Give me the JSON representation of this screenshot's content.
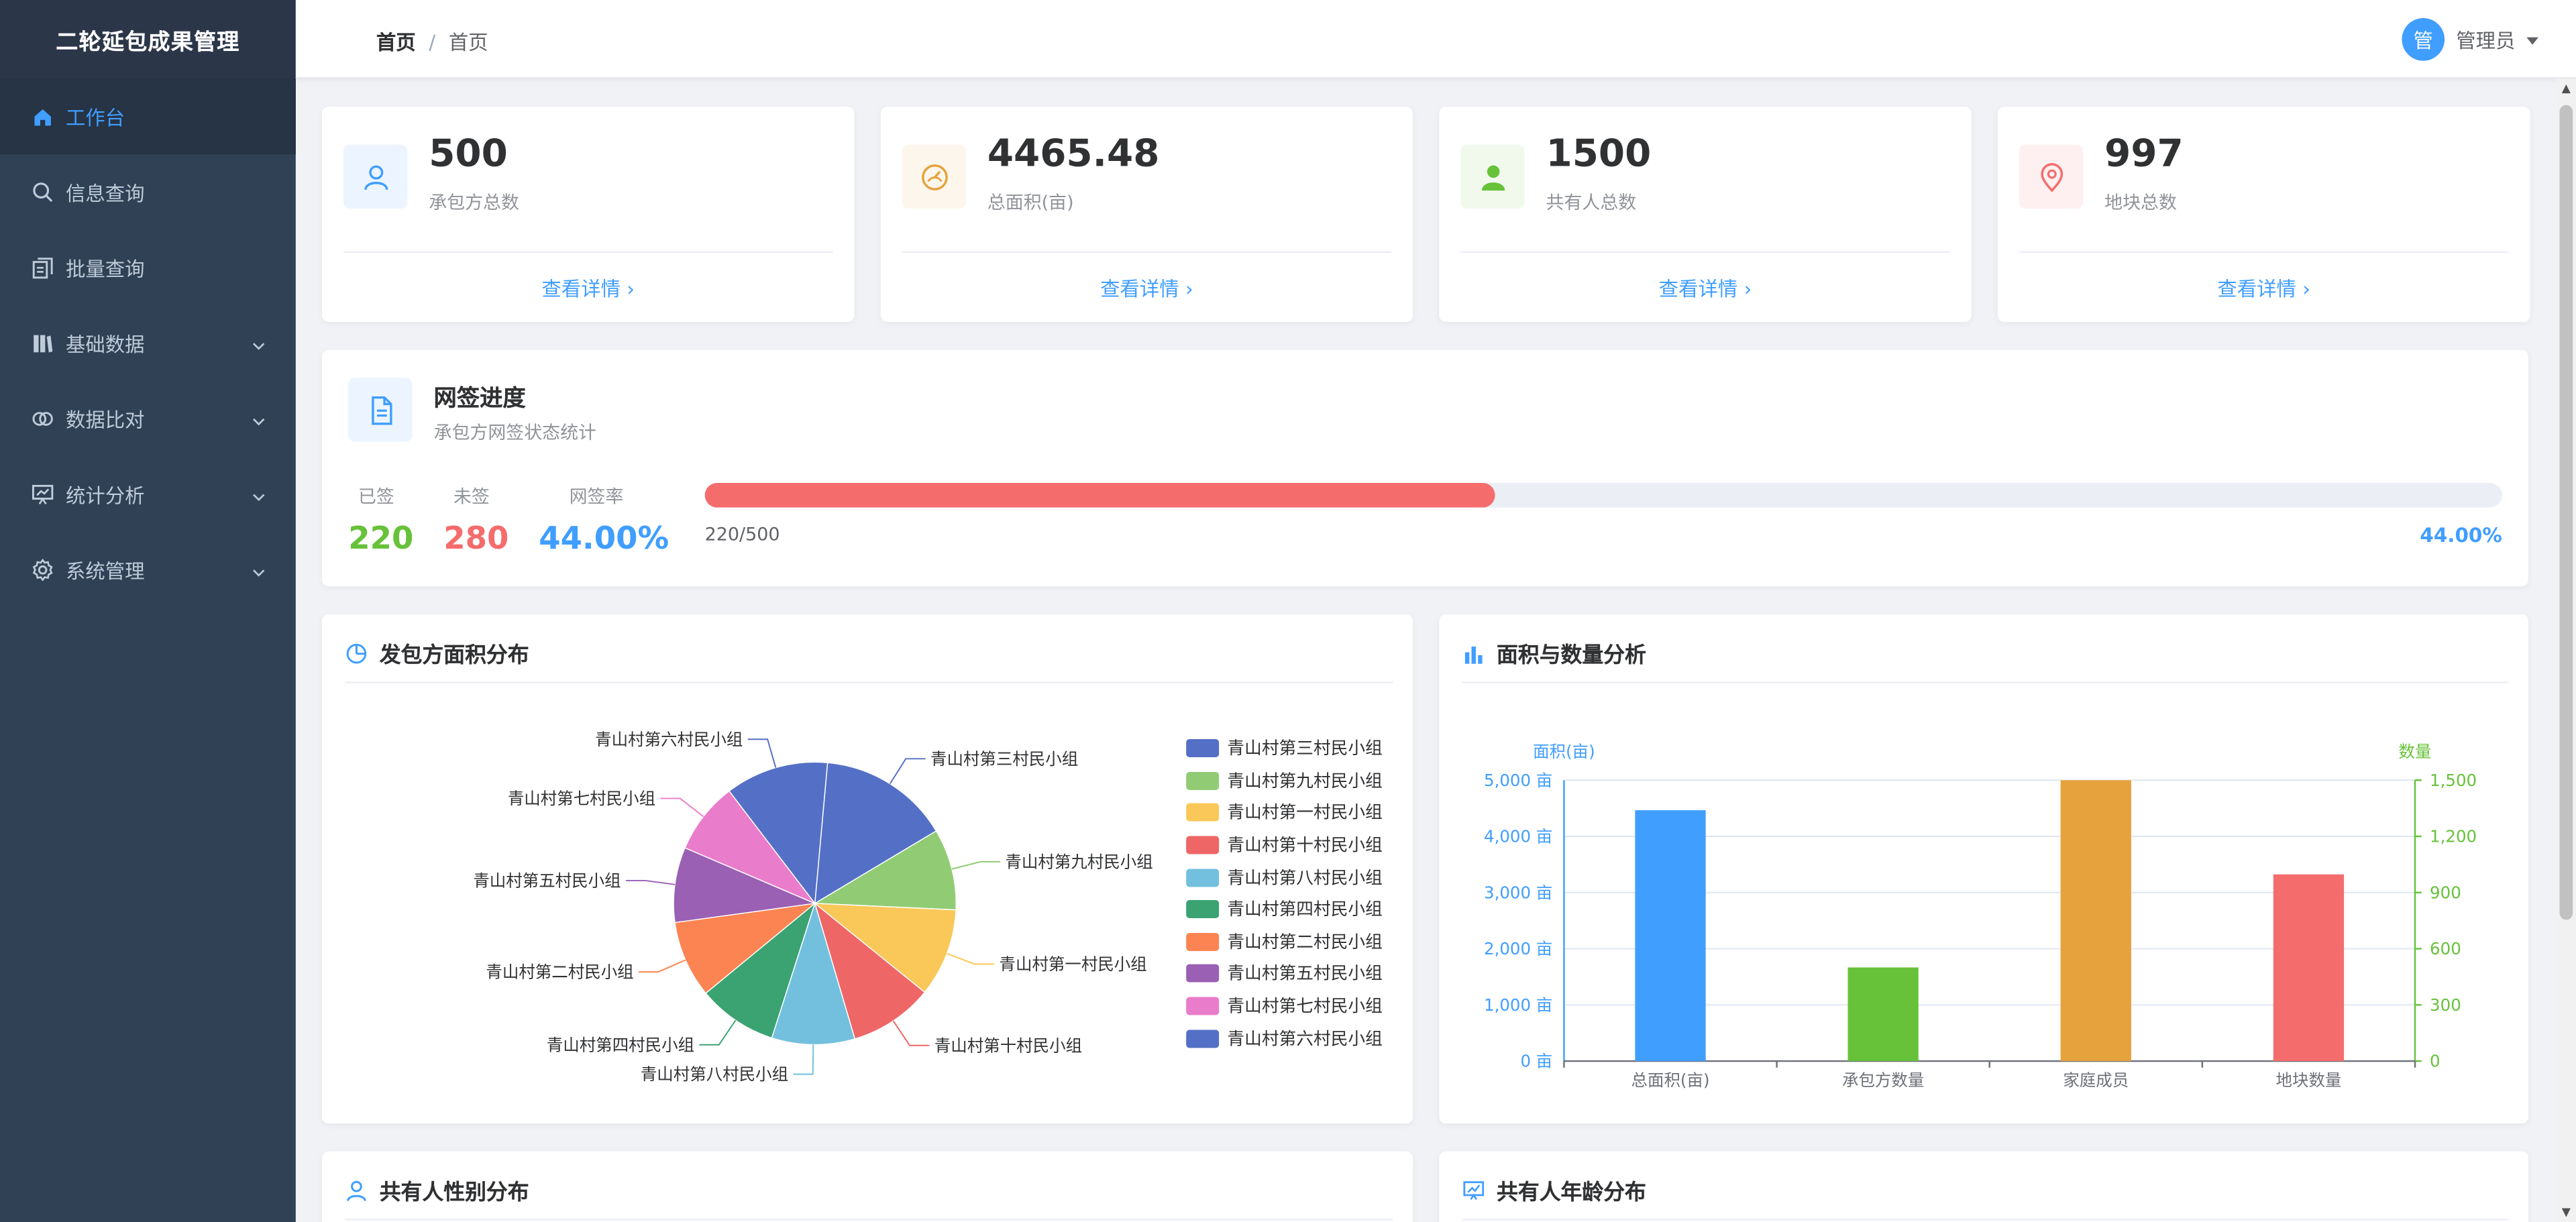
{
  "app": {
    "title": "二轮延包成果管理"
  },
  "sidebar": {
    "items": [
      {
        "label": "工作台",
        "icon": "home-icon",
        "active": true,
        "expandable": false
      },
      {
        "label": "信息查询",
        "icon": "search-icon",
        "active": false,
        "expandable": false
      },
      {
        "label": "批量查询",
        "icon": "documents-icon",
        "active": false,
        "expandable": false
      },
      {
        "label": "基础数据",
        "icon": "books-icon",
        "active": false,
        "expandable": true
      },
      {
        "label": "数据比对",
        "icon": "compare-icon",
        "active": false,
        "expandable": true
      },
      {
        "label": "统计分析",
        "icon": "presentation-chart-icon",
        "active": false,
        "expandable": true
      },
      {
        "label": "系统管理",
        "icon": "gear-icon",
        "active": false,
        "expandable": true
      }
    ]
  },
  "header": {
    "breadcrumb": [
      "首页",
      "首页"
    ],
    "breadcrumb_sep": "/",
    "user": {
      "avatar_text": "管",
      "name": "管理员"
    }
  },
  "stats": [
    {
      "value": "500",
      "label": "承包方总数",
      "link": "查看详情 ›",
      "icon": "user-icon",
      "color": "#409eff",
      "bg": "#ecf5ff"
    },
    {
      "value": "4465.48",
      "label": "总面积(亩)",
      "link": "查看详情 ›",
      "icon": "gauge-icon",
      "color": "#e6a23c",
      "bg": "#fdf6ec"
    },
    {
      "value": "1500",
      "label": "共有人总数",
      "link": "查看详情 ›",
      "icon": "person-filled-icon",
      "color": "#67c23a",
      "bg": "#f0f9eb"
    },
    {
      "value": "997",
      "label": "地块总数",
      "link": "查看详情 ›",
      "icon": "location-pin-icon",
      "color": "#f56c6c",
      "bg": "#fef0f0"
    }
  ],
  "sign_progress": {
    "title": "网签进度",
    "subtitle": "承包方网签状态统计",
    "signed_label": "已签",
    "signed": "220",
    "unsigned_label": "未签",
    "unsigned": "280",
    "rate_label": "网签率",
    "rate": "44.00%",
    "fraction": "220/500",
    "progress": 0.44,
    "colors": {
      "signed": "#67c23a",
      "unsigned": "#f56c6c",
      "rate": "#409eff",
      "bar": "#f56c6c"
    }
  },
  "pie_panel": {
    "title": "发包方面积分布",
    "icon": "pie-chart-icon"
  },
  "bar_panel": {
    "title": "面积与数量分析",
    "icon": "bar-chart-icon"
  },
  "bottom_panels": [
    {
      "title": "共有人性别分布",
      "icon": "user-icon"
    },
    {
      "title": "共有人年龄分布",
      "icon": "presentation-chart-icon"
    }
  ],
  "chart_data": [
    {
      "type": "pie",
      "title": "发包方面积分布",
      "categories": [
        "青山村第三村民小组",
        "青山村第九村民小组",
        "青山村第一村民小组",
        "青山村第十村民小组",
        "青山村第八村民小组",
        "青山村第四村民小组",
        "青山村第二村民小组",
        "青山村第五村民小组",
        "青山村第七村民小组",
        "青山村第六村民小组"
      ],
      "values": [
        15.0,
        9.3,
        10.1,
        9.6,
        9.5,
        9.1,
        8.8,
        8.6,
        8.2,
        11.8
      ],
      "colors": [
        "#5470c6",
        "#91cc75",
        "#fac858",
        "#ee6666",
        "#73c0de",
        "#3ba272",
        "#fc8452",
        "#9a60b4",
        "#ea7ccc",
        "#5470c6"
      ],
      "legend": "right"
    },
    {
      "type": "bar",
      "title": "面积与数量分析",
      "categories": [
        "总面积(亩)",
        "承包方数量",
        "家庭成员",
        "地块数量"
      ],
      "values": [
        4465.48,
        500,
        1500,
        997
      ],
      "axis": [
        "left",
        "right",
        "right",
        "right"
      ],
      "colors": [
        "#409eff",
        "#67c23a",
        "#e6a23c",
        "#f56c6c"
      ],
      "ylabel_left": "面积(亩)",
      "ylabel_right": "数量",
      "ylim_left": [
        0,
        5000
      ],
      "ylim_right": [
        0,
        1500
      ],
      "yticks_left": [
        "0 亩",
        "1,000 亩",
        "2,000 亩",
        "3,000 亩",
        "4,000 亩",
        "5,000 亩"
      ],
      "yticks_right": [
        "0",
        "300",
        "600",
        "900",
        "1,200",
        "1,500"
      ],
      "grid": true
    }
  ]
}
